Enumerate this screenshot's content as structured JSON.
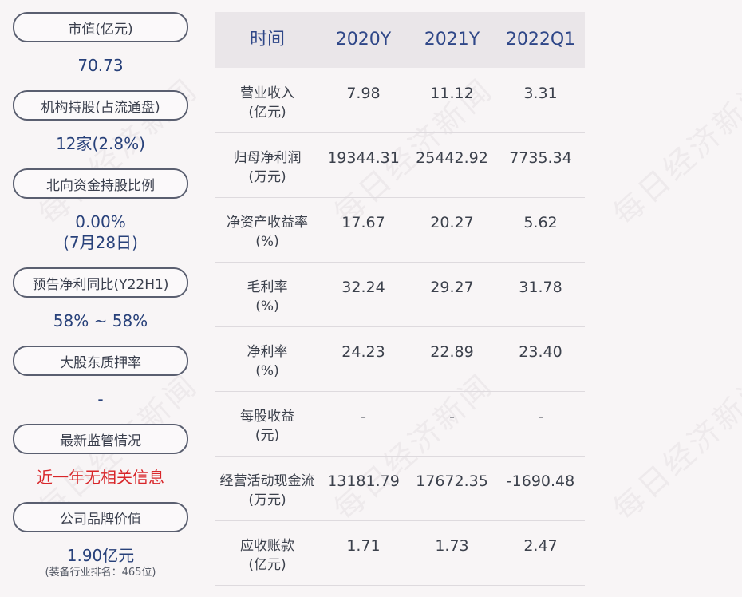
{
  "watermark": "每日经济新闻",
  "left": {
    "items": [
      {
        "label": "市值(亿元)",
        "value": "70.73"
      },
      {
        "label": "机构持股(占流通盘)",
        "value": "12家(2.8%)"
      },
      {
        "label": "北向资金持股比例",
        "value": "0.00%",
        "value2": "(7月28日)"
      },
      {
        "label": "预告净利同比(Y22H1)",
        "value": "58% ~ 58%"
      },
      {
        "label": "大股东质押率",
        "value": "-"
      },
      {
        "label": "最新监管情况",
        "value": "近一年无相关信息"
      },
      {
        "label": "公司品牌价值",
        "value": "1.90亿元",
        "note": "(装备行业排名：465位)"
      }
    ]
  },
  "table": {
    "headers": [
      "时间",
      "2020Y",
      "2021Y",
      "2022Q1"
    ],
    "rows": [
      {
        "label": "营业收入",
        "unit": "(亿元)",
        "values": [
          "7.98",
          "11.12",
          "3.31"
        ]
      },
      {
        "label": "归母净利润",
        "unit": "(万元)",
        "values": [
          "19344.31",
          "25442.92",
          "7735.34"
        ]
      },
      {
        "label": "净资产收益率",
        "unit": "(%)",
        "values": [
          "17.67",
          "20.27",
          "5.62"
        ]
      },
      {
        "label": "毛利率",
        "unit": "(%)",
        "values": [
          "32.24",
          "29.27",
          "31.78"
        ]
      },
      {
        "label": "净利率",
        "unit": "(%)",
        "values": [
          "24.23",
          "22.89",
          "23.40"
        ]
      },
      {
        "label": "每股收益",
        "unit": "(元)",
        "values": [
          "-",
          "-",
          "-"
        ]
      },
      {
        "label": "经营活动现金流",
        "unit": "(万元)",
        "values": [
          "13181.79",
          "17672.35",
          "-1690.48"
        ]
      },
      {
        "label": "应收账款",
        "unit": "(亿元)",
        "values": [
          "1.71",
          "1.73",
          "2.47"
        ]
      }
    ]
  }
}
